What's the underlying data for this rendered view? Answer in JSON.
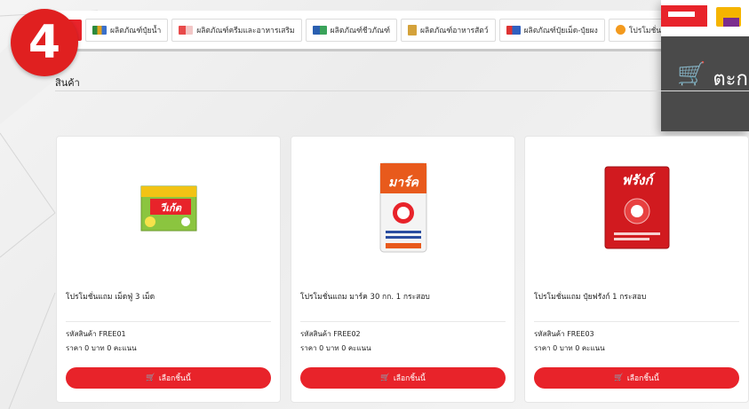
{
  "step_number": "4",
  "nav": {
    "tabs": [
      {
        "label": "ผลิตภัณฑ์ปุ๋ยน้ำ",
        "icon": "fertilizer-liquid-icon"
      },
      {
        "label": "ผลิตภัณฑ์ครีมและอาหารเสริม",
        "icon": "cream-supplement-icon"
      },
      {
        "label": "ผลิตภัณฑ์ชีวภัณฑ์",
        "icon": "bio-product-icon"
      },
      {
        "label": "ผลิตภัณฑ์อาหารสัตว์",
        "icon": "animal-feed-icon"
      },
      {
        "label": "ผลิตภัณฑ์ปุ๋ยเม็ด-ปุ๋ยผง",
        "icon": "granular-fertilizer-icon"
      },
      {
        "label": "โปรโมชั่นของ",
        "icon": "promotion-icon"
      }
    ]
  },
  "cart": {
    "label": "ตะก"
  },
  "section_title": "สินค้า",
  "products": [
    {
      "name": "โปรโมชั่นแถม เม็ดฟู่ 3 เม็ด",
      "code": "รหัสสินค้า FREE01",
      "price": "ราคา 0 บาท  0 คะแนน",
      "button": "เลือกชิ้นนี้",
      "package_text": "วีเก้ต"
    },
    {
      "name": "โปรโมชั่นแถม มาร์ค 30 กก. 1 กระสอบ",
      "code": "รหัสสินค้า FREE02",
      "price": "ราคา 0 บาท  0 คะแนน",
      "button": "เลือกชิ้นนี้",
      "package_text": "มาร์ค"
    },
    {
      "name": "โปรโมชั่นแถม ปุ๋ยฟรังก์ 1 กระสอบ",
      "code": "รหัสสินค้า FREE03",
      "price": "ราคา 0 บาท  0 คะแนน",
      "button": "เลือกชิ้นนี้",
      "package_text": "ฟรังก์"
    }
  ],
  "colors": {
    "accent": "#e8232a",
    "cart_bg": "#4a4a4a"
  }
}
